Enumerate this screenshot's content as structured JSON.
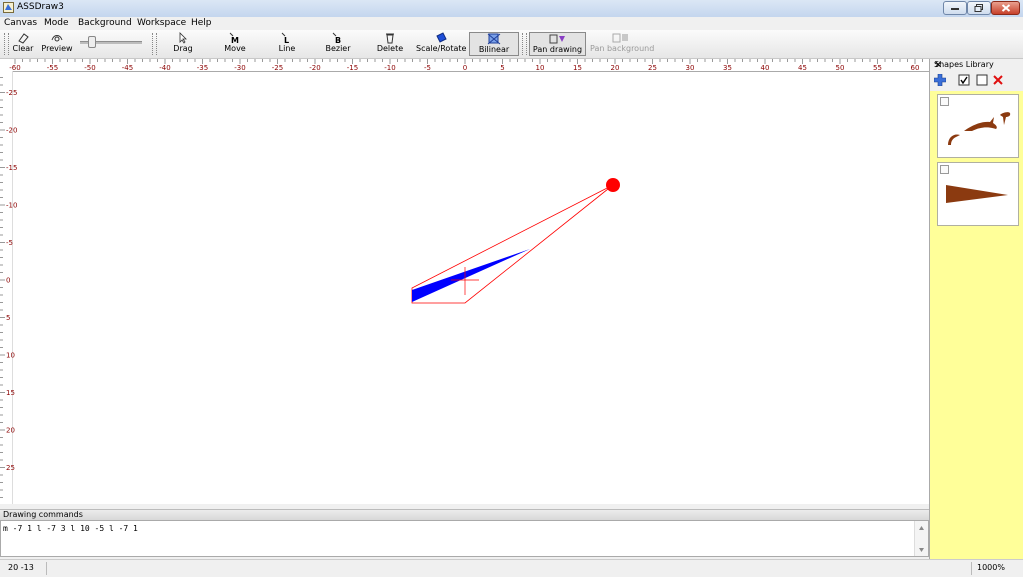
{
  "window": {
    "title": "ASSDraw3",
    "controls": [
      "minimize",
      "maximize",
      "close"
    ]
  },
  "menu": {
    "items": [
      "Canvas",
      "Mode",
      "Background",
      "Workspace",
      "Help"
    ]
  },
  "toolbar": {
    "tools": [
      {
        "label": "Clear",
        "icon": "eraser-icon"
      },
      {
        "label": "Preview",
        "icon": "preview-icon"
      },
      {
        "label": "Drag",
        "icon": "arrow-cursor-icon"
      },
      {
        "label": "Move",
        "icon": "move-m-icon"
      },
      {
        "label": "Line",
        "icon": "line-l-icon"
      },
      {
        "label": "Bezier",
        "icon": "bezier-b-icon"
      },
      {
        "label": "Delete",
        "icon": "delete-icon"
      },
      {
        "label": "Scale/Rotate",
        "icon": "scale-rotate-icon"
      },
      {
        "label": "Bilinear",
        "icon": "bilinear-icon",
        "pressed": true
      },
      {
        "label": "Pan drawing",
        "icon": "pan-drawing-icon",
        "pressed": true
      },
      {
        "label": "Pan background",
        "icon": "pan-background-icon",
        "disabled": true
      }
    ]
  },
  "ruler": {
    "top_labels": [
      "-60",
      "-55",
      "-50",
      "-45",
      "-40",
      "-35",
      "-30",
      "-25",
      "-20",
      "-15",
      "-10",
      "-5",
      "0",
      "5",
      "10",
      "15",
      "20",
      "25",
      "30",
      "35",
      "40",
      "45",
      "50",
      "55",
      "60"
    ],
    "left_labels": [
      "-25",
      "-20",
      "-15",
      "-10",
      "-5",
      "0",
      "5",
      "10",
      "15",
      "20",
      "25"
    ],
    "label_color": "#8b0000"
  },
  "drawing": {
    "fill_color": "#0000ff",
    "outline_color": "#ff0000",
    "handle_color": "#ff0000"
  },
  "commands_panel": {
    "title": "Drawing commands",
    "text": "m -7 1 l -7 3 l 10 -5 l -7 1"
  },
  "status": {
    "coords": "20  -13",
    "zoom": "1000%"
  },
  "shapes_library": {
    "title": "Shapes Library",
    "tools": [
      "add-icon",
      "check-all-icon",
      "uncheck-all-icon",
      "delete-icon"
    ],
    "shape_color": "#8b3a10"
  }
}
